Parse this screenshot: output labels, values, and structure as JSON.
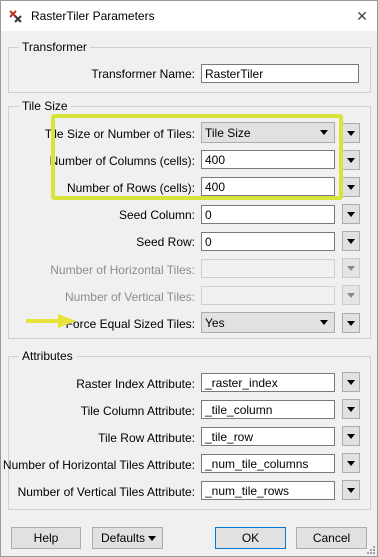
{
  "window": {
    "title": "RasterTiler Parameters",
    "close_glyph": "✕"
  },
  "transformer_group": {
    "title": "Transformer",
    "name_label": "Transformer Name:",
    "name_value": "RasterTiler"
  },
  "tile_size_group": {
    "title": "Tile Size",
    "tile_size_or_number_label": "Tile Size or Number of Tiles:",
    "tile_size_or_number_value": "Tile Size",
    "columns_label": "Number of Columns (cells):",
    "columns_value": "400",
    "rows_label": "Number of Rows (cells):",
    "rows_value": "400",
    "seed_column_label": "Seed Column:",
    "seed_column_value": "0",
    "seed_row_label": "Seed Row:",
    "seed_row_value": "0",
    "horizontal_tiles_label": "Number of Horizontal Tiles:",
    "horizontal_tiles_value": "",
    "vertical_tiles_label": "Number of Vertical Tiles:",
    "vertical_tiles_value": "",
    "force_equal_label": "Force Equal Sized Tiles:",
    "force_equal_value": "Yes"
  },
  "attributes_group": {
    "title": "Attributes",
    "raster_index_label": "Raster Index Attribute:",
    "raster_index_value": "_raster_index",
    "tile_column_label": "Tile Column Attribute:",
    "tile_column_value": "_tile_column",
    "tile_row_label": "Tile Row Attribute:",
    "tile_row_value": "_tile_row",
    "num_horizontal_label": "Number of Horizontal Tiles Attribute:",
    "num_horizontal_value": "_num_tile_columns",
    "num_vertical_label": "Number of Vertical Tiles Attribute:",
    "num_vertical_value": "_num_tile_rows"
  },
  "footer": {
    "help_label": "Help",
    "defaults_label": "Defaults",
    "ok_label": "OK",
    "cancel_label": "Cancel"
  },
  "colors": {
    "highlight": "#d7e43a",
    "arrow": "#e8e23a",
    "primary_border": "#0078d7"
  }
}
